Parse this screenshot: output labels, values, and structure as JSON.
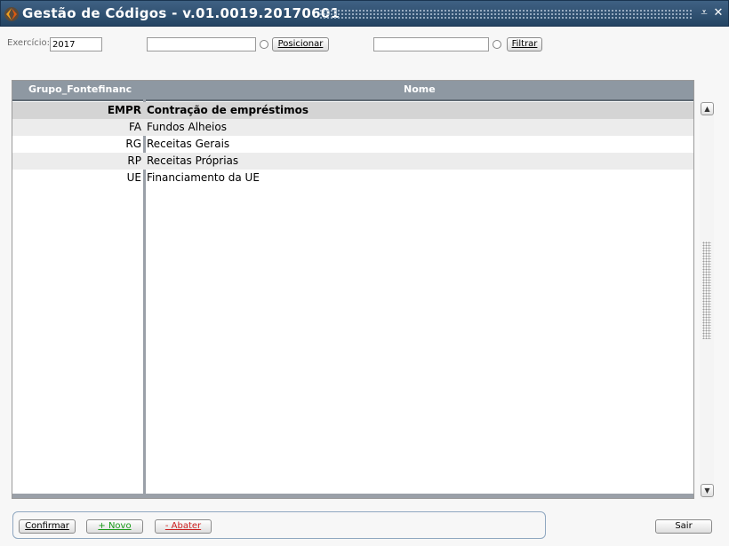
{
  "window": {
    "title": "Gestão de Códigos - v.01.0019.20170601",
    "minimize_glyph": "⩡",
    "close_glyph": "✕"
  },
  "filters": {
    "exercicio_label": "Exercício:",
    "exercicio_value": "2017",
    "position_value": "",
    "position_button": "Posicionar",
    "filter_value": "",
    "filter_button": "Filtrar"
  },
  "grid": {
    "columns": [
      "Grupo_Fontefinanc",
      "Nome"
    ],
    "rows": [
      {
        "code": "EMPR",
        "name": "Contração de empréstimos"
      },
      {
        "code": "FA",
        "name": "Fundos Alheios"
      },
      {
        "code": "RG",
        "name": "Receitas Gerais"
      },
      {
        "code": "RP",
        "name": "Receitas Próprias"
      },
      {
        "code": "UE",
        "name": "Financiamento da UE"
      }
    ]
  },
  "buttons": {
    "confirm": "Confirmar",
    "new": "+ Novo",
    "delete": "- Abater",
    "exit": "Sair"
  },
  "colors": {
    "title_bar": "#2f5173",
    "new_text": "#1a9a1a",
    "delete_text": "#cc1f1f"
  },
  "icons": {
    "app": "app-logo-icon",
    "scroll_up": "▲",
    "scroll_down": "▼"
  }
}
